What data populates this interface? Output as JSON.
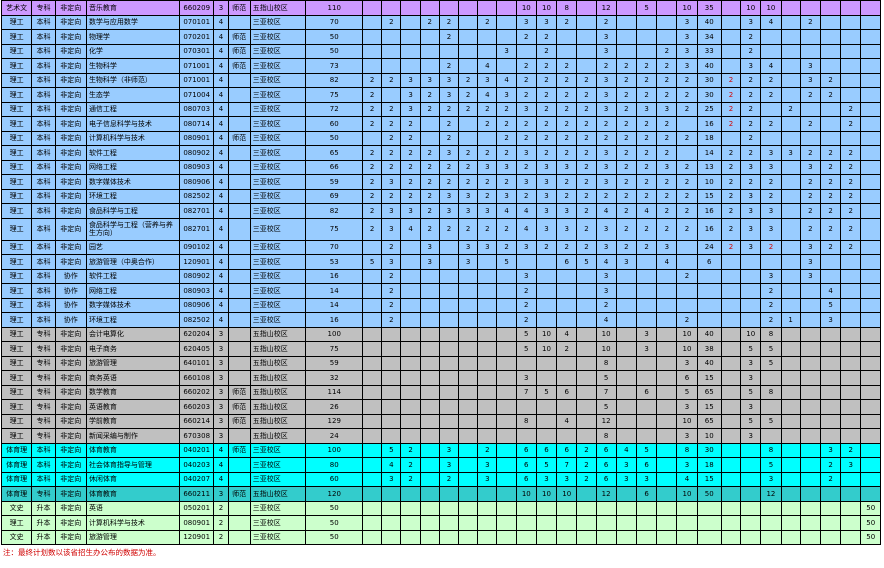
{
  "colors": {
    "purple": "#cc99ff",
    "blue": "#99ccff",
    "gray": "#c0c0c0",
    "cyan": "#00ffff",
    "teal": "#33cccc",
    "lightgreen": "#ccffcc",
    "note_red": "#d00000"
  },
  "rows": [
    {
      "bg": "purple",
      "cells": [
        "艺术文",
        "专科",
        "非定向",
        "音乐教育",
        "660209",
        "3",
        "师范",
        "五指山校区",
        "110",
        "",
        "",
        "",
        "",
        "",
        "",
        "",
        "",
        "10",
        "10",
        "8",
        "",
        "12",
        "",
        "5",
        "",
        "10",
        "35",
        "",
        "10",
        "10",
        "",
        "",
        "",
        "",
        ""
      ]
    },
    {
      "bg": "blue",
      "cells": [
        "理工",
        "本科",
        "非定向",
        "数学与应用数学",
        "070101",
        "4",
        "",
        "三亚校区",
        "70",
        "",
        "2",
        "",
        "2",
        "2",
        "",
        "2",
        "",
        "3",
        "3",
        "2",
        "",
        "2",
        "",
        "",
        "",
        "3",
        "40",
        "",
        "3",
        "4",
        "",
        "2",
        "",
        "",
        ""
      ]
    },
    {
      "bg": "blue",
      "cells": [
        "理工",
        "本科",
        "非定向",
        "物理学",
        "070201",
        "4",
        "师范",
        "三亚校区",
        "50",
        "",
        "",
        "",
        "",
        "2",
        "",
        "",
        "",
        "2",
        "2",
        "",
        "",
        "3",
        "",
        "",
        "",
        "3",
        "34",
        "",
        "2",
        "",
        "",
        "",
        "",
        "",
        ""
      ]
    },
    {
      "bg": "blue",
      "cells": [
        "理工",
        "本科",
        "非定向",
        "化学",
        "070301",
        "4",
        "师范",
        "三亚校区",
        "50",
        "",
        "",
        "",
        "",
        "",
        "",
        "",
        "3",
        "",
        "2",
        "",
        "",
        "3",
        "",
        "",
        "2",
        "3",
        "33",
        "",
        "2",
        "",
        "",
        "",
        "",
        "",
        ""
      ]
    },
    {
      "bg": "blue",
      "cells": [
        "理工",
        "本科",
        "非定向",
        "生物科学",
        "071001",
        "4",
        "师范",
        "三亚校区",
        "73",
        "",
        "",
        "",
        "",
        "2",
        "",
        "4",
        "",
        "2",
        "2",
        "2",
        "",
        "2",
        "2",
        "2",
        "2",
        "3",
        "40",
        "",
        "3",
        "4",
        "",
        "3",
        "",
        "",
        ""
      ]
    },
    {
      "bg": "blue",
      "cells": [
        "理工",
        "本科",
        "非定向",
        "生物科学（非师范）",
        "071001",
        "4",
        "",
        "三亚校区",
        "82",
        "2",
        "2",
        "3",
        "3",
        "3",
        "2",
        "3",
        "4",
        "2",
        "2",
        "2",
        "2",
        "3",
        "2",
        "2",
        "2",
        "2",
        "30",
        "2",
        "2",
        "2",
        "",
        "3",
        "2",
        "",
        ""
      ]
    },
    {
      "bg": "blue",
      "cells": [
        "理工",
        "本科",
        "非定向",
        "生态学",
        "071004",
        "4",
        "",
        "三亚校区",
        "75",
        "2",
        "",
        "3",
        "2",
        "3",
        "2",
        "4",
        "3",
        "2",
        "2",
        "2",
        "2",
        "3",
        "2",
        "2",
        "2",
        "2",
        "30",
        "2",
        "2",
        "2",
        "",
        "2",
        "2",
        "",
        ""
      ]
    },
    {
      "bg": "blue",
      "cells": [
        "理工",
        "本科",
        "非定向",
        "通信工程",
        "080703",
        "4",
        "",
        "三亚校区",
        "72",
        "2",
        "2",
        "3",
        "2",
        "2",
        "2",
        "2",
        "2",
        "3",
        "2",
        "2",
        "2",
        "3",
        "2",
        "3",
        "3",
        "2",
        "25",
        "2",
        "2",
        "",
        "2",
        "",
        "",
        "2",
        ""
      ]
    },
    {
      "bg": "blue",
      "cells": [
        "理工",
        "本科",
        "非定向",
        "电子信息科学与技术",
        "080714",
        "4",
        "",
        "三亚校区",
        "60",
        "2",
        "2",
        "2",
        "",
        "2",
        "",
        "2",
        "2",
        "2",
        "2",
        "2",
        "2",
        "2",
        "2",
        "2",
        "2",
        "",
        "16",
        "2",
        "2",
        "2",
        "",
        "2",
        "",
        "2",
        ""
      ]
    },
    {
      "bg": "blue",
      "cells": [
        "理工",
        "本科",
        "非定向",
        "计算机科学与技术",
        "080901",
        "4",
        "师范",
        "三亚校区",
        "50",
        "",
        "2",
        "2",
        "",
        "2",
        "",
        "",
        "2",
        "2",
        "2",
        "2",
        "2",
        "2",
        "2",
        "2",
        "2",
        "2",
        "18",
        "",
        "2",
        "",
        "",
        "",
        "",
        "",
        ""
      ]
    },
    {
      "bg": "blue",
      "cells": [
        "理工",
        "本科",
        "非定向",
        "软件工程",
        "080902",
        "4",
        "",
        "三亚校区",
        "65",
        "2",
        "2",
        "2",
        "2",
        "3",
        "2",
        "2",
        "2",
        "3",
        "2",
        "2",
        "2",
        "3",
        "2",
        "2",
        "2",
        "",
        "14",
        "2",
        "2",
        "3",
        "3",
        "2",
        "2",
        "2",
        ""
      ]
    },
    {
      "bg": "blue",
      "cells": [
        "理工",
        "本科",
        "非定向",
        "网络工程",
        "080903",
        "4",
        "",
        "三亚校区",
        "66",
        "2",
        "2",
        "2",
        "2",
        "2",
        "2",
        "3",
        "3",
        "2",
        "3",
        "3",
        "2",
        "3",
        "2",
        "2",
        "3",
        "2",
        "13",
        "2",
        "3",
        "3",
        "",
        "3",
        "2",
        "2",
        ""
      ]
    },
    {
      "bg": "blue",
      "cells": [
        "理工",
        "本科",
        "非定向",
        "数字媒体技术",
        "080906",
        "4",
        "",
        "三亚校区",
        "59",
        "2",
        "3",
        "2",
        "2",
        "2",
        "2",
        "2",
        "2",
        "3",
        "3",
        "2",
        "2",
        "3",
        "2",
        "2",
        "2",
        "2",
        "10",
        "2",
        "2",
        "2",
        "",
        "2",
        "2",
        "2",
        ""
      ]
    },
    {
      "bg": "blue",
      "cells": [
        "理工",
        "本科",
        "非定向",
        "环境工程",
        "082502",
        "4",
        "",
        "三亚校区",
        "69",
        "2",
        "2",
        "2",
        "2",
        "3",
        "3",
        "2",
        "3",
        "2",
        "3",
        "2",
        "2",
        "2",
        "2",
        "2",
        "2",
        "2",
        "15",
        "2",
        "3",
        "2",
        "",
        "2",
        "2",
        "2",
        ""
      ]
    },
    {
      "bg": "blue",
      "cells": [
        "理工",
        "本科",
        "非定向",
        "食品科学与工程",
        "082701",
        "4",
        "",
        "三亚校区",
        "82",
        "2",
        "3",
        "3",
        "2",
        "3",
        "3",
        "3",
        "4",
        "4",
        "3",
        "3",
        "2",
        "4",
        "2",
        "4",
        "2",
        "2",
        "16",
        "2",
        "3",
        "3",
        "",
        "2",
        "2",
        "2",
        ""
      ]
    },
    {
      "bg": "blue",
      "tall": true,
      "cells": [
        "理工",
        "本科",
        "非定向",
        "食品科学与工程（营养与养生方向）",
        "082701",
        "4",
        "",
        "三亚校区",
        "75",
        "2",
        "3",
        "4",
        "2",
        "2",
        "2",
        "2",
        "2",
        "4",
        "3",
        "3",
        "2",
        "3",
        "2",
        "2",
        "2",
        "2",
        "16",
        "2",
        "3",
        "3",
        "",
        "2",
        "2",
        "2",
        ""
      ]
    },
    {
      "bg": "blue",
      "cells": [
        "理工",
        "本科",
        "非定向",
        "园艺",
        "090102",
        "4",
        "",
        "三亚校区",
        "70",
        "",
        "2",
        "",
        "3",
        "",
        "3",
        "3",
        "2",
        "3",
        "2",
        "2",
        "2",
        "3",
        "2",
        "2",
        "3",
        "",
        "24",
        "2",
        "3",
        "2",
        "",
        "3",
        "2",
        "2",
        ""
      ]
    },
    {
      "bg": "blue",
      "cells": [
        "理工",
        "本科",
        "非定向",
        "旅游管理（中奥合作）",
        "120901",
        "4",
        "",
        "三亚校区",
        "53",
        "5",
        "3",
        "",
        "3",
        "",
        "3",
        "",
        "5",
        "",
        "",
        "6",
        "5",
        "4",
        "3",
        "",
        "4",
        "",
        "6",
        "",
        "",
        "",
        "",
        "3",
        "",
        "",
        ""
      ]
    },
    {
      "bg": "blue",
      "cells": [
        "理工",
        "本科",
        "协作",
        "软件工程",
        "080902",
        "4",
        "",
        "三亚校区",
        "16",
        "",
        "2",
        "",
        "",
        "",
        "",
        "",
        "",
        "3",
        "",
        "",
        "",
        "3",
        "",
        "",
        "",
        "2",
        "",
        "",
        "",
        "3",
        "",
        "3",
        "",
        "",
        ""
      ]
    },
    {
      "bg": "blue",
      "cells": [
        "理工",
        "本科",
        "协作",
        "网络工程",
        "080903",
        "4",
        "",
        "三亚校区",
        "14",
        "",
        "2",
        "",
        "",
        "",
        "",
        "",
        "",
        "2",
        "",
        "",
        "",
        "3",
        "",
        "",
        "",
        "",
        "",
        "",
        "",
        "2",
        "",
        "",
        "4",
        "",
        ""
      ]
    },
    {
      "bg": "blue",
      "cells": [
        "理工",
        "本科",
        "协作",
        "数字媒体技术",
        "080906",
        "4",
        "",
        "三亚校区",
        "14",
        "",
        "2",
        "",
        "",
        "",
        "",
        "",
        "",
        "2",
        "",
        "",
        "",
        "2",
        "",
        "",
        "",
        "",
        "",
        "",
        "",
        "2",
        "",
        "",
        "5",
        "",
        ""
      ]
    },
    {
      "bg": "blue",
      "cells": [
        "理工",
        "本科",
        "协作",
        "环境工程",
        "082502",
        "4",
        "",
        "三亚校区",
        "16",
        "",
        "2",
        "",
        "",
        "",
        "",
        "",
        "",
        "2",
        "",
        "",
        "",
        "4",
        "",
        "",
        "",
        "2",
        "",
        "",
        "",
        "2",
        "1",
        "",
        "3",
        "",
        ""
      ]
    },
    {
      "bg": "gray",
      "cells": [
        "理工",
        "专科",
        "非定向",
        "会计电算化",
        "620204",
        "3",
        "",
        "五指山校区",
        "100",
        "",
        "",
        "",
        "",
        "",
        "",
        "",
        "",
        "5",
        "10",
        "4",
        "",
        "10",
        "",
        "3",
        "",
        "10",
        "40",
        "",
        "10",
        "8",
        "",
        "",
        "",
        "",
        ""
      ]
    },
    {
      "bg": "gray",
      "cells": [
        "理工",
        "专科",
        "非定向",
        "电子商务",
        "620405",
        "3",
        "",
        "五指山校区",
        "75",
        "",
        "",
        "",
        "",
        "",
        "",
        "",
        "",
        "5",
        "10",
        "2",
        "",
        "10",
        "",
        "3",
        "",
        "10",
        "38",
        "",
        "5",
        "5",
        "",
        "",
        "",
        "",
        ""
      ]
    },
    {
      "bg": "gray",
      "cells": [
        "理工",
        "专科",
        "非定向",
        "旅游管理",
        "640101",
        "3",
        "",
        "五指山校区",
        "59",
        "",
        "",
        "",
        "",
        "",
        "",
        "",
        "",
        "",
        "",
        "",
        "",
        "8",
        "",
        "",
        "",
        "3",
        "40",
        "",
        "3",
        "5",
        "",
        "",
        "",
        "",
        ""
      ]
    },
    {
      "bg": "gray",
      "cells": [
        "理工",
        "专科",
        "非定向",
        "商务英语",
        "660108",
        "3",
        "",
        "五指山校区",
        "32",
        "",
        "",
        "",
        "",
        "",
        "",
        "",
        "",
        "3",
        "",
        "",
        "",
        "5",
        "",
        "",
        "",
        "6",
        "15",
        "",
        "3",
        "",
        "",
        "",
        "",
        "",
        ""
      ]
    },
    {
      "bg": "gray",
      "cells": [
        "理工",
        "专科",
        "非定向",
        "数学教育",
        "660202",
        "3",
        "师范",
        "五指山校区",
        "114",
        "",
        "",
        "",
        "",
        "",
        "",
        "",
        "",
        "7",
        "5",
        "6",
        "",
        "7",
        "",
        "6",
        "",
        "5",
        "65",
        "",
        "5",
        "8",
        "",
        "",
        "",
        "",
        ""
      ]
    },
    {
      "bg": "gray",
      "cells": [
        "理工",
        "专科",
        "非定向",
        "英语教育",
        "660203",
        "3",
        "师范",
        "五指山校区",
        "26",
        "",
        "",
        "",
        "",
        "",
        "",
        "",
        "",
        "",
        "",
        "",
        "",
        "5",
        "",
        "",
        "",
        "3",
        "15",
        "",
        "3",
        "",
        "",
        "",
        "",
        "",
        ""
      ]
    },
    {
      "bg": "gray",
      "cells": [
        "理工",
        "专科",
        "非定向",
        "学前教育",
        "660214",
        "3",
        "师范",
        "五指山校区",
        "129",
        "",
        "",
        "",
        "",
        "",
        "",
        "",
        "",
        "8",
        "",
        "4",
        "",
        "12",
        "",
        "",
        "",
        "10",
        "65",
        "",
        "5",
        "5",
        "",
        "",
        "",
        "",
        ""
      ]
    },
    {
      "bg": "gray",
      "cells": [
        "理工",
        "专科",
        "非定向",
        "新闻采编与制作",
        "670308",
        "3",
        "",
        "五指山校区",
        "24",
        "",
        "",
        "",
        "",
        "",
        "",
        "",
        "",
        "",
        "",
        "",
        "",
        "8",
        "",
        "",
        "",
        "3",
        "10",
        "",
        "3",
        "",
        "",
        "",
        "",
        "",
        ""
      ]
    },
    {
      "bg": "cyan",
      "cells": [
        "体育理",
        "本科",
        "非定向",
        "体育教育",
        "040201",
        "4",
        "师范",
        "三亚校区",
        "100",
        "",
        "5",
        "2",
        "",
        "3",
        "",
        "2",
        "",
        "6",
        "6",
        "6",
        "2",
        "6",
        "4",
        "5",
        "",
        "8",
        "30",
        "",
        "",
        "8",
        "",
        "",
        "3",
        "2",
        ""
      ]
    },
    {
      "bg": "cyan",
      "cells": [
        "体育理",
        "本科",
        "非定向",
        "社会体育指导与管理",
        "040203",
        "4",
        "",
        "三亚校区",
        "80",
        "",
        "4",
        "2",
        "",
        "3",
        "",
        "3",
        "",
        "6",
        "5",
        "7",
        "2",
        "6",
        "3",
        "6",
        "",
        "3",
        "18",
        "",
        "",
        "5",
        "",
        "",
        "2",
        "3",
        ""
      ]
    },
    {
      "bg": "cyan",
      "cells": [
        "体育理",
        "本科",
        "非定向",
        "休闲体育",
        "040207",
        "4",
        "",
        "三亚校区",
        "60",
        "",
        "3",
        "2",
        "",
        "2",
        "",
        "3",
        "",
        "6",
        "3",
        "3",
        "2",
        "6",
        "3",
        "3",
        "",
        "4",
        "15",
        "",
        "",
        "3",
        "",
        "",
        "2",
        "",
        ""
      ]
    },
    {
      "bg": "teal",
      "cells": [
        "体育理",
        "专科",
        "非定向",
        "体育教育",
        "660211",
        "3",
        "师范",
        "五指山校区",
        "120",
        "",
        "",
        "",
        "",
        "",
        "",
        "",
        "",
        "10",
        "10",
        "10",
        "",
        "12",
        "",
        "6",
        "",
        "10",
        "50",
        "",
        "",
        "12",
        "",
        "",
        "",
        "",
        ""
      ]
    },
    {
      "bg": "lightgreen",
      "cells": [
        "文史",
        "升本",
        "非定向",
        "英语",
        "050201",
        "2",
        "",
        "三亚校区",
        "50",
        "",
        "",
        "",
        "",
        "",
        "",
        "",
        "",
        "",
        "",
        "",
        "",
        "",
        "",
        "",
        "",
        "",
        "",
        "",
        "",
        "",
        "",
        "",
        "",
        "",
        "50"
      ]
    },
    {
      "bg": "lightgreen",
      "cells": [
        "理工",
        "升本",
        "非定向",
        "计算机科学与技术",
        "080901",
        "2",
        "",
        "三亚校区",
        "50",
        "",
        "",
        "",
        "",
        "",
        "",
        "",
        "",
        "",
        "",
        "",
        "",
        "",
        "",
        "",
        "",
        "",
        "",
        "",
        "",
        "",
        "",
        "",
        "",
        "",
        "50"
      ]
    },
    {
      "bg": "lightgreen",
      "cells": [
        "文史",
        "升本",
        "非定向",
        "旅游管理",
        "120901",
        "2",
        "",
        "三亚校区",
        "50",
        "",
        "",
        "",
        "",
        "",
        "",
        "",
        "",
        "",
        "",
        "",
        "",
        "",
        "",
        "",
        "",
        "",
        "",
        "",
        "",
        "",
        "",
        "",
        "",
        "",
        "50"
      ]
    }
  ],
  "red_cells": [
    {
      "row": 5,
      "col": 27
    },
    {
      "row": 6,
      "col": 27
    },
    {
      "row": 7,
      "col": 27
    },
    {
      "row": 8,
      "col": 27
    },
    {
      "row": 16,
      "col": 27
    },
    {
      "row": 16,
      "col": 29
    }
  ],
  "footnote": "注：最终计划数以该省招生办公布的数据为准。"
}
